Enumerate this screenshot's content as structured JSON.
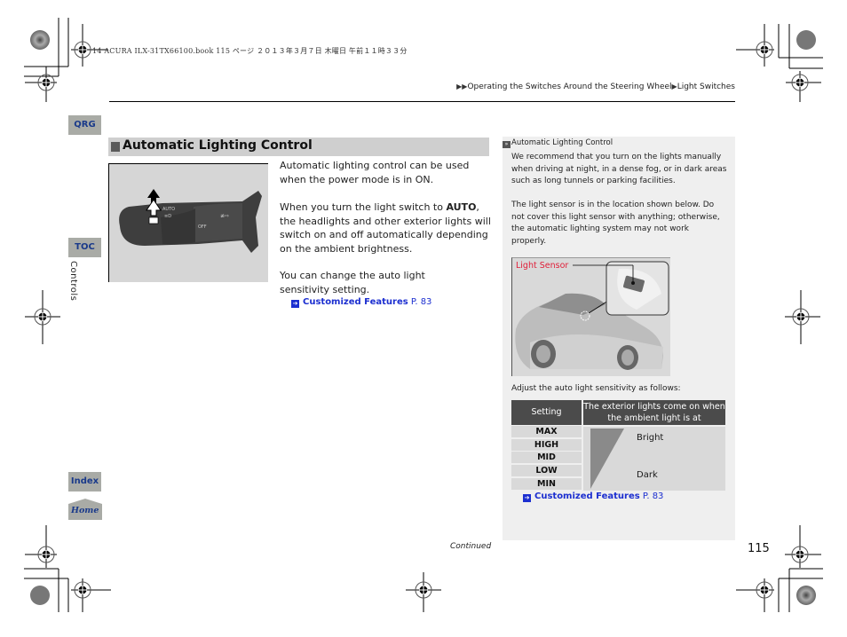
{
  "print_header": {
    "text": "14 ACURA ILX-31TX66100.book  115 ページ  ２０１３年３月７日  木曜日  午前１１時３３分"
  },
  "breadcrumb": {
    "items": [
      "Operating the Switches Around the Steering Wheel",
      "Light Switches"
    ]
  },
  "nav": {
    "qrg": "QRG",
    "toc": "TOC",
    "section": "Controls",
    "index": "Index",
    "home": "Home"
  },
  "main": {
    "title": "Automatic Lighting Control",
    "para1": "Automatic lighting control can be used when the power mode is in ON.",
    "para2_before": "When you turn the light switch to ",
    "para2_bold": "AUTO",
    "para2_after": ", the headlights and other exterior lights will switch on and off automatically depending on the ambient brightness.",
    "para3": "You can change the auto light sensitivity setting.",
    "link_label": "Customized Features",
    "link_page": "P. 83",
    "figure_alt": "light-switch-lever",
    "lever_labels": [
      "AUTO",
      "OFF"
    ]
  },
  "sidebar": {
    "title": "Automatic Lighting Control",
    "para1": "We recommend that you turn on the lights manually when driving at night, in a dense fog, or in dark areas such as long tunnels or parking facilities.",
    "para2": "The light sensor is in the location shown below. Do not cover this light sensor with anything; otherwise, the automatic lighting system may not work properly.",
    "figure_label": "Light Sensor",
    "adjust_text": "Adjust the auto light sensitivity as follows:",
    "table": {
      "header_setting": "Setting",
      "header_desc": "The exterior lights come on when the ambient light is at",
      "settings": [
        "MAX",
        "HIGH",
        "MID",
        "LOW",
        "MIN"
      ],
      "scale_top": "Bright",
      "scale_bottom": "Dark"
    },
    "link_label": "Customized Features",
    "link_page": "P. 83"
  },
  "footer": {
    "continued": "Continued",
    "page_number": "115"
  },
  "colors": {
    "link": "#1c2fd0",
    "nav_tab_bg": "#a9aba6",
    "nav_tab_text": "#1a3a8a",
    "title_bar": "#cfcfcf",
    "sensor_label": "#e0203a",
    "table_header": "#4b4b4b"
  }
}
